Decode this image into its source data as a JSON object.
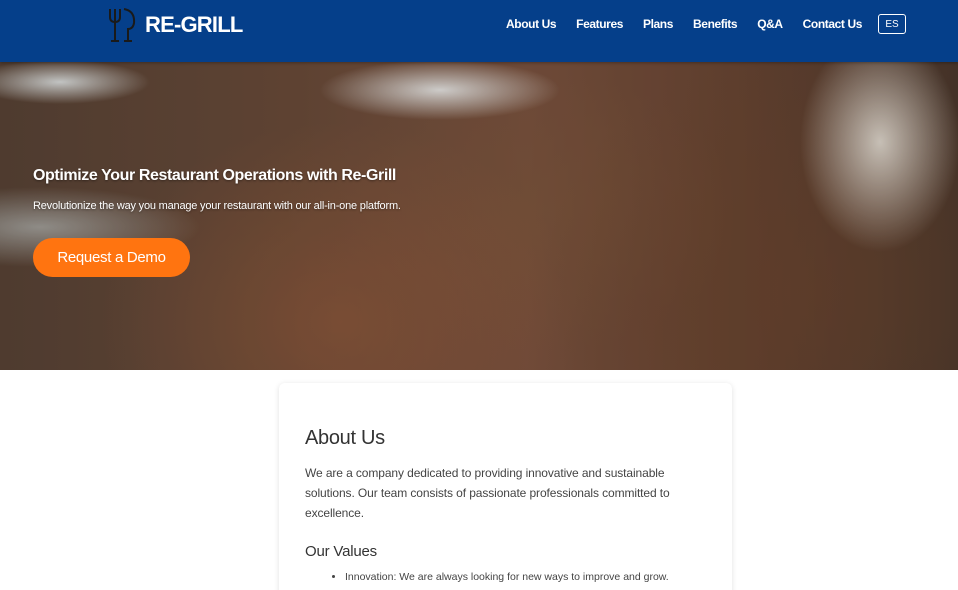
{
  "header": {
    "logo_text": "RE-GRILL",
    "logo_icon": "cutlery-glass-icon",
    "nav": [
      {
        "label": "About Us"
      },
      {
        "label": "Features"
      },
      {
        "label": "Plans"
      },
      {
        "label": "Benefits"
      },
      {
        "label": "Q&A"
      },
      {
        "label": "Contact Us"
      }
    ],
    "lang_button": "ES",
    "colors": {
      "background": "#053f8a",
      "text": "#ffffff"
    }
  },
  "hero": {
    "title": "Optimize Your Restaurant Operations with Re-Grill",
    "subtitle": "Revolutionize the way you manage your restaurant with our all-in-one platform.",
    "cta": "Request a Demo",
    "colors": {
      "cta": "#ff7410"
    }
  },
  "about": {
    "title": "About Us",
    "text": "We are a company dedicated to providing innovative and sustainable solutions. Our team consists of passionate professionals committed to excellence.",
    "values_title": "Our Values",
    "values": [
      "Innovation: We are always looking for new ways to improve and grow."
    ]
  }
}
